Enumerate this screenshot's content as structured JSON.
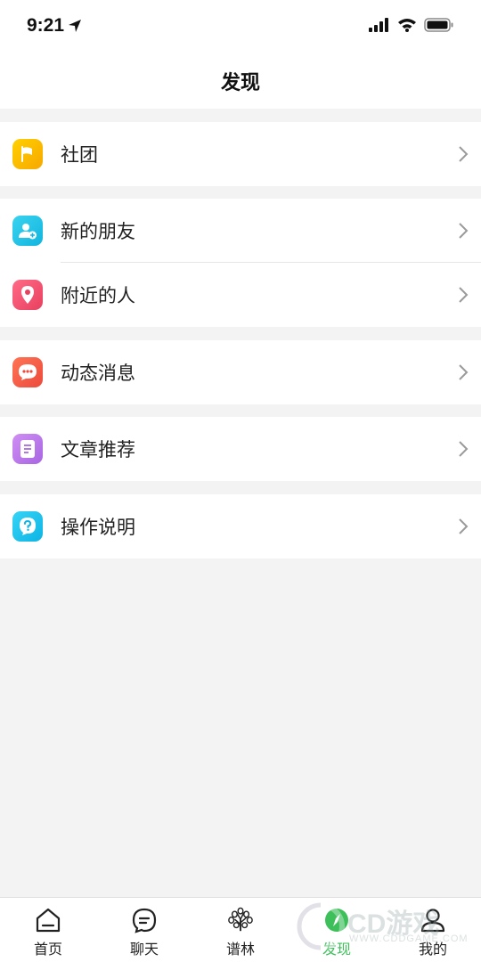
{
  "status_bar": {
    "time": "9:21"
  },
  "header": {
    "title": "发现"
  },
  "groups": [
    {
      "items": [
        {
          "label": "社团",
          "icon": "flag-icon",
          "color": "#f8b500"
        }
      ]
    },
    {
      "items": [
        {
          "label": "新的朋友",
          "icon": "add-friend-icon",
          "color": "#22c3e6"
        },
        {
          "label": "附近的人",
          "icon": "location-pin-icon",
          "color": "#f0506e"
        }
      ]
    },
    {
      "items": [
        {
          "label": "动态消息",
          "icon": "chat-bubble-icon",
          "color": "#f25b4a"
        }
      ]
    },
    {
      "items": [
        {
          "label": "文章推荐",
          "icon": "article-icon",
          "color": "#b57ae8"
        }
      ]
    },
    {
      "items": [
        {
          "label": "操作说明",
          "icon": "help-icon",
          "color": "#1ec3ec"
        }
      ]
    }
  ],
  "tabs": [
    {
      "label": "首页",
      "icon": "home-icon"
    },
    {
      "label": "聊天",
      "icon": "chat-icon"
    },
    {
      "label": "谱林",
      "icon": "tree-icon"
    },
    {
      "label": "发现",
      "icon": "discover-icon",
      "active": true
    },
    {
      "label": "我的",
      "icon": "profile-icon"
    }
  ],
  "colors": {
    "active_tab": "#3dbf5a",
    "background": "#f3f3f3"
  },
  "watermark": {
    "brand": "CD游戏",
    "url": "WWW.CDDGAME.COM"
  }
}
